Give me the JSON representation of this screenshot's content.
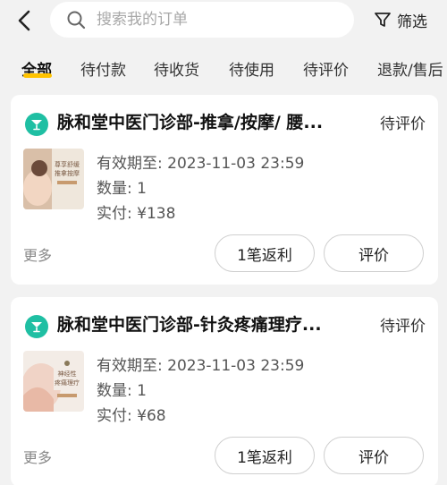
{
  "search": {
    "placeholder": "搜索我的订单",
    "filter_label": "筛选"
  },
  "tabs": [
    {
      "label": "全部",
      "active": true
    },
    {
      "label": "待付款"
    },
    {
      "label": "待收货"
    },
    {
      "label": "待使用"
    },
    {
      "label": "待评价"
    },
    {
      "label": "退款/售后"
    }
  ],
  "colors": {
    "accent_underline": "#ffc300",
    "shop_icon": "#1fbfa3",
    "background": "#f2f2f2"
  },
  "orders": [
    {
      "shop_icon": "cocktail-glass-icon",
      "title": "脉和堂中医门诊部-推拿/按摩/ 腰...",
      "status": "待评价",
      "thumb_text": [
        "尊享舒缓",
        "推拿按摩"
      ],
      "expiry_label": "有效期至:",
      "expiry_value": "2023-11-03 23:59",
      "qty_label": "数量:",
      "qty_value": "1",
      "paid_label": "实付:",
      "paid_value": "¥138",
      "more": "更多",
      "rebate_button": "1笔返利",
      "review_button": "评价"
    },
    {
      "shop_icon": "cocktail-glass-icon",
      "title": "脉和堂中医门诊部-针灸疼痛理疗...",
      "status": "待评价",
      "thumb_text": [
        "神经性",
        "疼痛理疗"
      ],
      "expiry_label": "有效期至:",
      "expiry_value": "2023-11-03 23:59",
      "qty_label": "数量:",
      "qty_value": "1",
      "paid_label": "实付:",
      "paid_value": "¥68",
      "more": "更多",
      "rebate_button": "1笔返利",
      "review_button": "评价"
    }
  ]
}
